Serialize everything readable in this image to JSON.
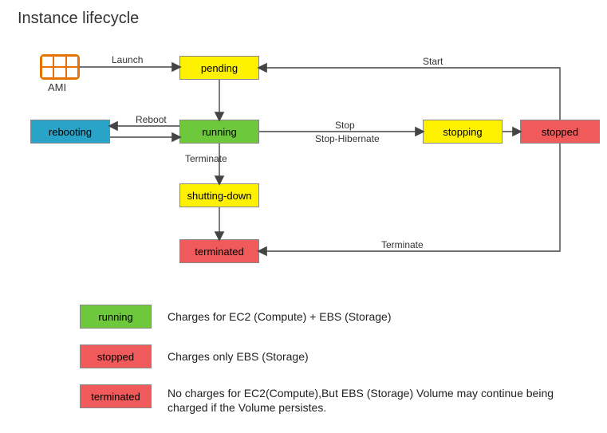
{
  "title": "Instance lifecycle",
  "ami": {
    "label": "AMI"
  },
  "states": {
    "pending": "pending",
    "rebooting": "rebooting",
    "running": "running",
    "stopping": "stopping",
    "stopped": "stopped",
    "shutting_down": "shutting-down",
    "terminated": "terminated"
  },
  "edges": {
    "launch": "Launch",
    "start": "Start",
    "reboot": "Reboot",
    "stop": "Stop",
    "stop_hibernate": "Stop-Hibernate",
    "terminate": "Terminate",
    "terminate2": "Terminate"
  },
  "legend": {
    "running": {
      "label": "running",
      "desc": "Charges for EC2 (Compute) + EBS (Storage)"
    },
    "stopped": {
      "label": "stopped",
      "desc": "Charges only EBS (Storage)"
    },
    "terminated": {
      "label": "terminated",
      "desc": "No charges for EC2(Compute),But EBS (Storage) Volume may continue being charged if the Volume persistes."
    }
  }
}
